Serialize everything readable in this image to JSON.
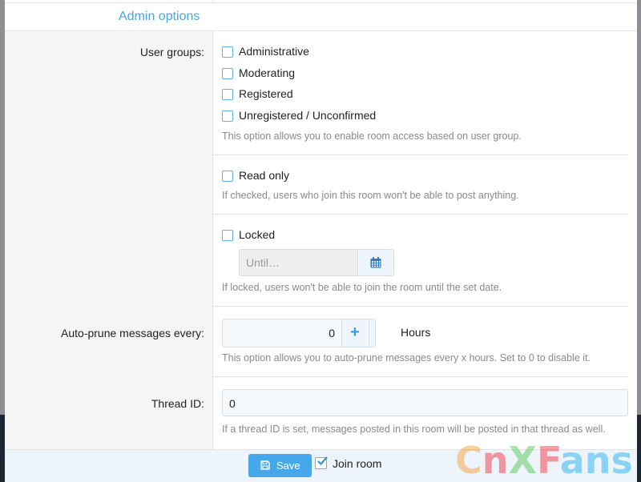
{
  "section": {
    "title": "Admin options"
  },
  "user_groups": {
    "label": "User groups:",
    "options": [
      {
        "label": "Administrative",
        "checked": false
      },
      {
        "label": "Moderating",
        "checked": false
      },
      {
        "label": "Registered",
        "checked": false
      },
      {
        "label": "Unregistered / Unconfirmed",
        "checked": false
      }
    ],
    "hint": "This option allows you to enable room access based on user group."
  },
  "read_only": {
    "label": "Read only",
    "checked": false,
    "hint": "If checked, users who join this room won't be able to post anything."
  },
  "locked": {
    "label": "Locked",
    "checked": false,
    "date_placeholder": "Until…",
    "date_icon": "calendar-icon",
    "hint": "If locked, users won't be able to join the room until the set date."
  },
  "auto_prune": {
    "label": "Auto-prune messages every:",
    "value": "0",
    "plus": "+",
    "minus": "−",
    "unit": "Hours",
    "hint": "This option allows you to auto-prune messages every x hours. Set to 0 to disable it."
  },
  "thread_id": {
    "label": "Thread ID:",
    "value": "0",
    "hint": "If a thread ID is set, messages posted in this room will be posted in that thread as well."
  },
  "footer": {
    "save_label": "Save",
    "save_icon": "floppy-disk-icon",
    "join_label": "Join room",
    "join_checked": true
  },
  "watermark": {
    "parts": [
      "C",
      "n",
      "X",
      "F",
      "ans"
    ]
  },
  "colors": {
    "accent": "#47a7eb",
    "checkbox_border": "#62b0ea"
  }
}
